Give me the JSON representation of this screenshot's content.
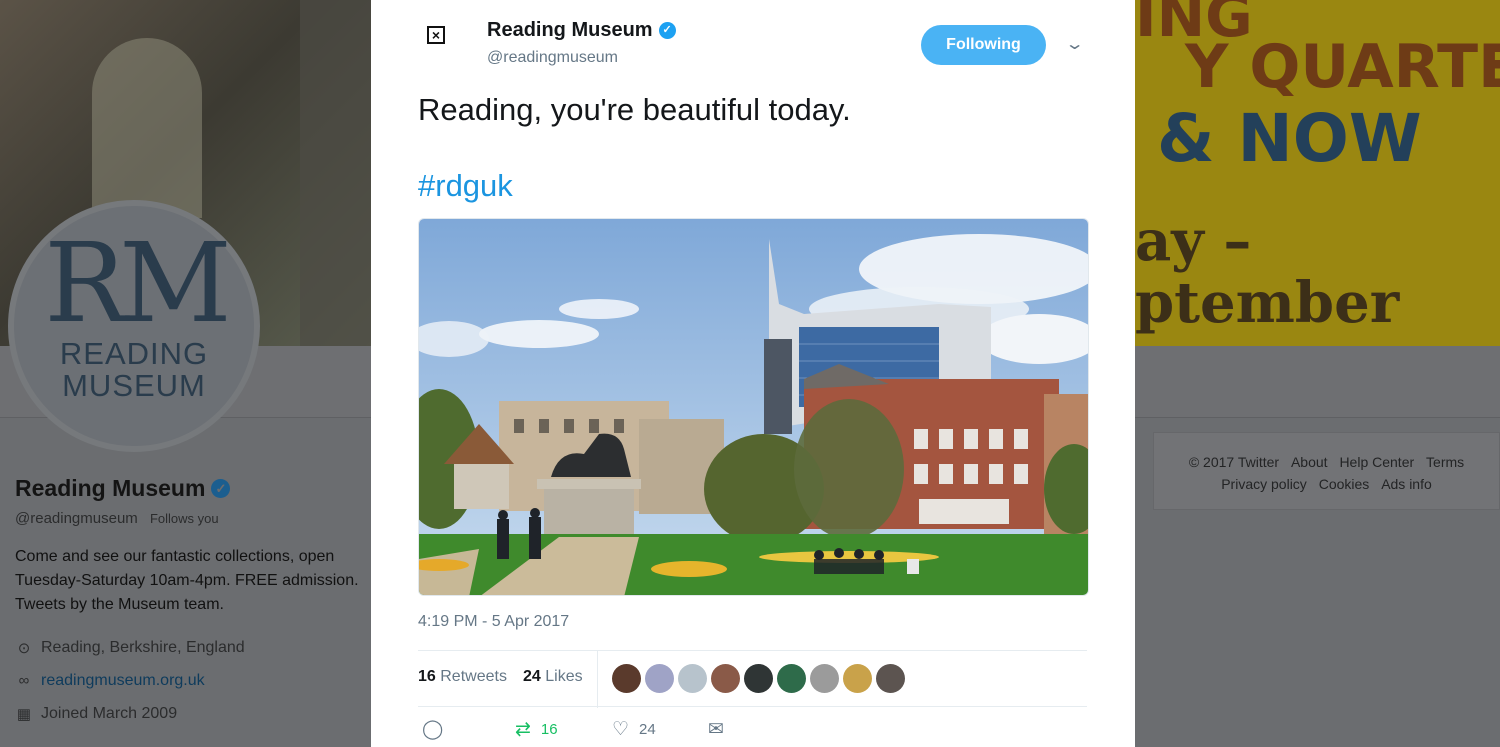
{
  "modal": {
    "account_name": "Reading Museum",
    "account_handle": "@readingmuseum",
    "follow_button": "Following",
    "tweet_text": "Reading, you're beautiful today.",
    "hashtag": "#rdguk",
    "timestamp": "4:19 PM - 5 Apr 2017",
    "retweets_count": "16",
    "retweets_label": "Retweets",
    "likes_count": "24",
    "likes_label": "Likes",
    "action_retweet_count": "16",
    "action_like_count": "24",
    "liker_avatar_colors": [
      "#5a3a2c",
      "#9fa3c6",
      "#b7c3cc",
      "#8a5a48",
      "#2f3535",
      "#2e6b4a",
      "#9b9b9b",
      "#c9a24a",
      "#5c5450"
    ]
  },
  "profile": {
    "avatar_monogram": "RM",
    "avatar_line1": "READING",
    "avatar_line2": "MUSEUM",
    "name": "Reading Museum",
    "handle": "@readingmuseum",
    "follows_you": "Follows you",
    "bio": "Come and see our fantastic collections, open Tuesday-Saturday 10am-4pm. FREE admission. Tweets by the Museum team.",
    "location": "Reading, Berkshire, England",
    "website": "readingmuseum.org.uk",
    "joined": "Joined March 2009"
  },
  "poster": {
    "line1": "ING",
    "line2": "Y QUARTER",
    "line3": "& NOW",
    "line4": "ay –",
    "line5": "ptember"
  },
  "footer": {
    "copyright": "© 2017 Twitter",
    "about": "About",
    "help_center": "Help Center",
    "terms": "Terms",
    "privacy": "Privacy policy",
    "cookies": "Cookies",
    "ads_info": "Ads info"
  }
}
